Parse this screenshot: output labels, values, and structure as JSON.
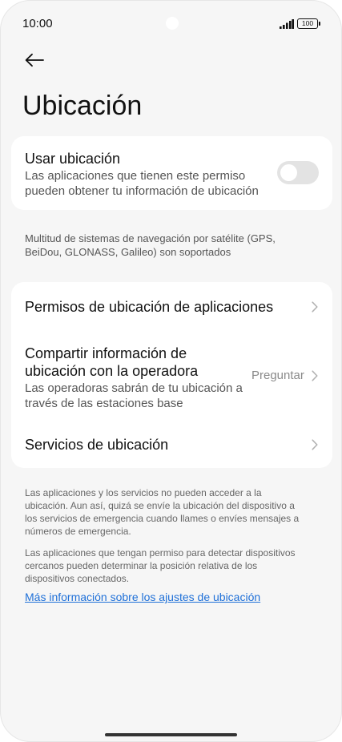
{
  "status_bar": {
    "time": "10:00",
    "battery": "100"
  },
  "header": {
    "back_icon": "arrow-left-icon",
    "title": "Ubicación"
  },
  "location_card": {
    "title": "Usar ubicación",
    "subtitle_line1": "Las aplicaciones que tienen este permiso",
    "subtitle_line2": "pueden obtener tu información de ubicación",
    "toggle_on": false
  },
  "satellite_note": {
    "line1": "Multitud de sistemas de navegación por satélite (GPS,",
    "line2": "BeiDou, GLONASS, Galileo) son soportados"
  },
  "settings_card": {
    "app_permissions": {
      "title": "Permisos de ubicación de aplicaciones"
    },
    "share_carrier": {
      "title_line1": "Compartir información de",
      "title_line2": "ubicación con la operadora",
      "subtitle_line1": "Las operadoras sabrán de tu ubicación a",
      "subtitle_line2": "través de las estaciones base",
      "value": "Preguntar"
    },
    "location_services": {
      "title": "Servicios de ubicación"
    }
  },
  "footer": {
    "paragraph1": [
      "Las aplicaciones y los servicios no pueden acceder a la",
      "ubicación. Aun así, quizá se envíe la ubicación del dispositivo a",
      "los servicios de emergencia cuando llames o envíes mensajes a",
      "números de emergencia."
    ],
    "paragraph2": [
      "Las aplicaciones que tengan permiso para detectar dispositivos",
      "cercanos pueden determinar la posición relativa de los",
      "dispositivos conectados."
    ],
    "link": "Más información sobre los ajustes de ubicación"
  },
  "colors": {
    "background": "#f6f6f6",
    "card": "#ffffff",
    "link": "#1f70d8",
    "toggle_off": "#e3e3e3"
  }
}
